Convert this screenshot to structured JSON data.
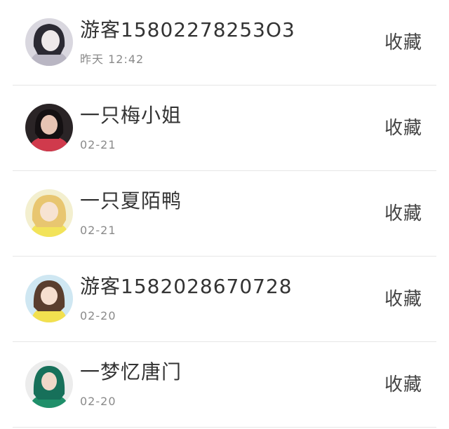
{
  "items": [
    {
      "name": "游客15802278253O3",
      "time": "昨天 12:42",
      "action": "收藏",
      "avatar": {
        "bg": "#d9d7df",
        "hair": "#2b2a33",
        "skin": "#eee9ea",
        "cloth": "#b9b6c3"
      }
    },
    {
      "name": "一只梅小姐",
      "time": "02-21",
      "action": "收藏",
      "avatar": {
        "bg": "#2a2426",
        "hair": "#141012",
        "skin": "#e7c4b4",
        "cloth": "#d03a4c"
      }
    },
    {
      "name": "一只夏陌鸭",
      "time": "02-21",
      "action": "收藏",
      "avatar": {
        "bg": "#f3efcf",
        "hair": "#e8c670",
        "skin": "#f7e3d2",
        "cloth": "#f2e35a"
      }
    },
    {
      "name": "游客1582028670728",
      "time": "02-20",
      "action": "收藏",
      "avatar": {
        "bg": "#cfe7f2",
        "hair": "#5a3e2e",
        "skin": "#f6dfcf",
        "cloth": "#f2e04f"
      }
    },
    {
      "name": "一梦忆唐门",
      "time": "02-20",
      "action": "收藏",
      "avatar": {
        "bg": "#ececec",
        "hair": "#17705a",
        "skin": "#f0d8c8",
        "cloth": "#1f8f6a"
      }
    }
  ]
}
